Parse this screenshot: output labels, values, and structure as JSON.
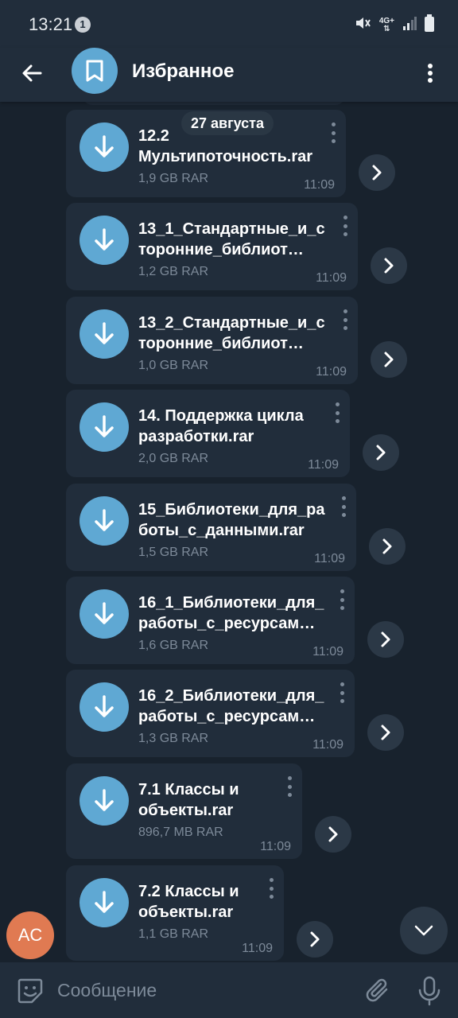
{
  "status_bar": {
    "time": "13:21",
    "notification_count": "1",
    "network_label": "4G+"
  },
  "header": {
    "title": "Избранное",
    "avatar_icon": "bookmark-icon"
  },
  "date_chip": "27 августа",
  "messages": [
    {
      "name": "12.2\nМультипоточность.rar",
      "size": "1,9 GB RAR",
      "time": "11:09"
    },
    {
      "name": "13_1_Стандартные_и_с\nторонние_библиот…",
      "size": "1,2 GB RAR",
      "time": "11:09"
    },
    {
      "name": "13_2_Стандартные_и_с\nторонние_библиот…",
      "size": "1,0 GB RAR",
      "time": "11:09"
    },
    {
      "name": "14. Поддержка цикла\nразработки.rar",
      "size": "2,0 GB RAR",
      "time": "11:09"
    },
    {
      "name": "15_Библиотеки_для_ра\nботы_с_данными.rar",
      "size": "1,5 GB RAR",
      "time": "11:09"
    },
    {
      "name": "16_1_Библиотеки_для_\nработы_с_ресурсам…",
      "size": "1,6 GB RAR",
      "time": "11:09"
    },
    {
      "name": "16_2_Библиотеки_для_\nработы_с_ресурсам…",
      "size": "1,3 GB RAR",
      "time": "11:09"
    },
    {
      "name": "7.1 Классы и\nобъекты.rar",
      "size": "896,7 MB RAR",
      "time": "11:09"
    },
    {
      "name": "7.2 Классы и\nобъекты.rar",
      "size": "1,1 GB RAR",
      "time": "11:09"
    }
  ],
  "sender_avatar_initials": "AC",
  "composer": {
    "placeholder": "Сообщение"
  },
  "colors": {
    "background": "#18222d",
    "bar": "#212d3b",
    "bubble": "#212d3b",
    "accent": "#5fa8d3",
    "muted_text": "#7d8a99",
    "avatar_orange": "#e07a52"
  }
}
